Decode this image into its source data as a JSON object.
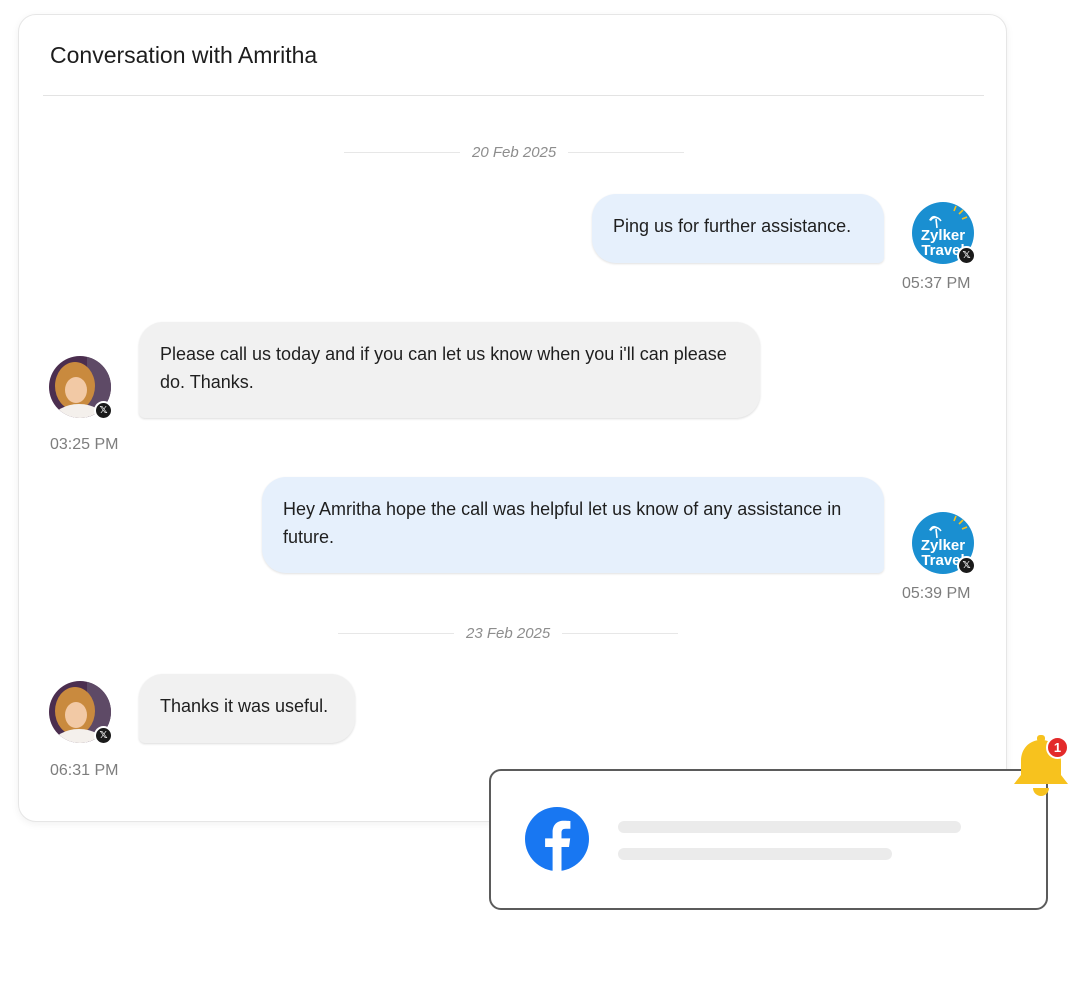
{
  "conversation": {
    "title": "Conversation with Amritha",
    "dates": [
      "20 Feb 2025",
      "23 Feb 2025"
    ],
    "messages": [
      {
        "direction": "outgoing",
        "text": "Ping us for further assistance.",
        "time": "05:37 PM",
        "sender": "Zylker Travel",
        "channel": "x-icon"
      },
      {
        "direction": "incoming",
        "text": "Please call us today and if you can let us know when you i'll can please do. Thanks.",
        "time": "03:25 PM",
        "sender": "Amritha",
        "channel": "x-icon"
      },
      {
        "direction": "outgoing",
        "text": "Hey Amritha hope the call was helpful let us know of any assistance in future.",
        "time": "05:39 PM",
        "sender": "Zylker Travel",
        "channel": "x-icon"
      },
      {
        "direction": "incoming",
        "text": "Thanks it was useful.",
        "time": "06:31 PM",
        "sender": "Amritha",
        "channel": "x-icon"
      }
    ]
  },
  "brand": {
    "logo_line1": "Zylker",
    "logo_line2": "Travel",
    "logo_color": "#1a8fd1"
  },
  "notification": {
    "channel_icon": "facebook-icon",
    "channel_color": "#1877f2",
    "badge_count": "1",
    "bell_color": "#f7c21e",
    "badge_color": "#e32a2a"
  },
  "colors": {
    "outgoing_bubble": "#e6f0fc",
    "incoming_bubble": "#f1f1f1"
  }
}
